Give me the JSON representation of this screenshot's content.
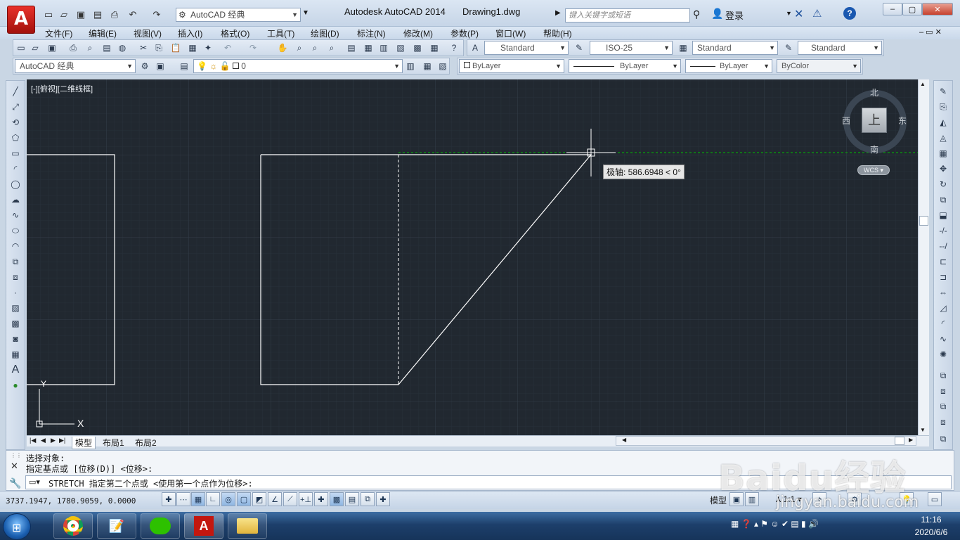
{
  "window": {
    "app_title": "Autodesk AutoCAD 2014",
    "document_title": "Drawing1.dwg",
    "workspace": "AutoCAD 经典",
    "search_placeholder": "键入关键字或短语",
    "login_label": "登录",
    "app_logo_letter": "A"
  },
  "menu": {
    "items": [
      "文件(F)",
      "编辑(E)",
      "视图(V)",
      "插入(I)",
      "格式(O)",
      "工具(T)",
      "绘图(D)",
      "标注(N)",
      "修改(M)",
      "参数(P)",
      "窗口(W)",
      "帮助(H)"
    ]
  },
  "styles_toolbar": {
    "text_style": "Standard",
    "dim_style": "ISO-25",
    "table_style": "Standard",
    "multileader_style": "Standard"
  },
  "layers_toolbar": {
    "workspace": "AutoCAD 经典",
    "current_layer": "0",
    "color": "ByLayer",
    "linetype": "ByLayer",
    "lineweight": "ByLayer",
    "plot_style": "ByColor"
  },
  "viewport": {
    "label": "[-][俯视][二维线框]",
    "tooltip": "极轴: 586.6948 < 0°",
    "ucs_x": "X",
    "ucs_y": "Y",
    "viewcube": {
      "north": "北",
      "south": "南",
      "east": "东",
      "west": "西",
      "top": "上",
      "wcs": "WCS"
    }
  },
  "layout_tabs": [
    "模型",
    "布局1",
    "布局2"
  ],
  "command": {
    "history": [
      "选择对象:",
      "指定基点或 [位移(D)] <位移>:"
    ],
    "current": "STRETCH 指定第二个点或 <使用第一个点作为位移>:"
  },
  "status": {
    "coordinates": "3737.1947, 1780.9059, 0.0000",
    "model_label": "模型",
    "annotation_scale": "1:1"
  },
  "taskbar": {
    "time": "11:16",
    "date": "2020/6/6"
  },
  "watermark": {
    "logo": "Baidu经验",
    "url": "jingyan.baidu.com"
  },
  "colors": {
    "canvas_bg": "#212830",
    "grid": "#2c343e",
    "geometry": "#ffffff",
    "tracking": "#00c000"
  }
}
